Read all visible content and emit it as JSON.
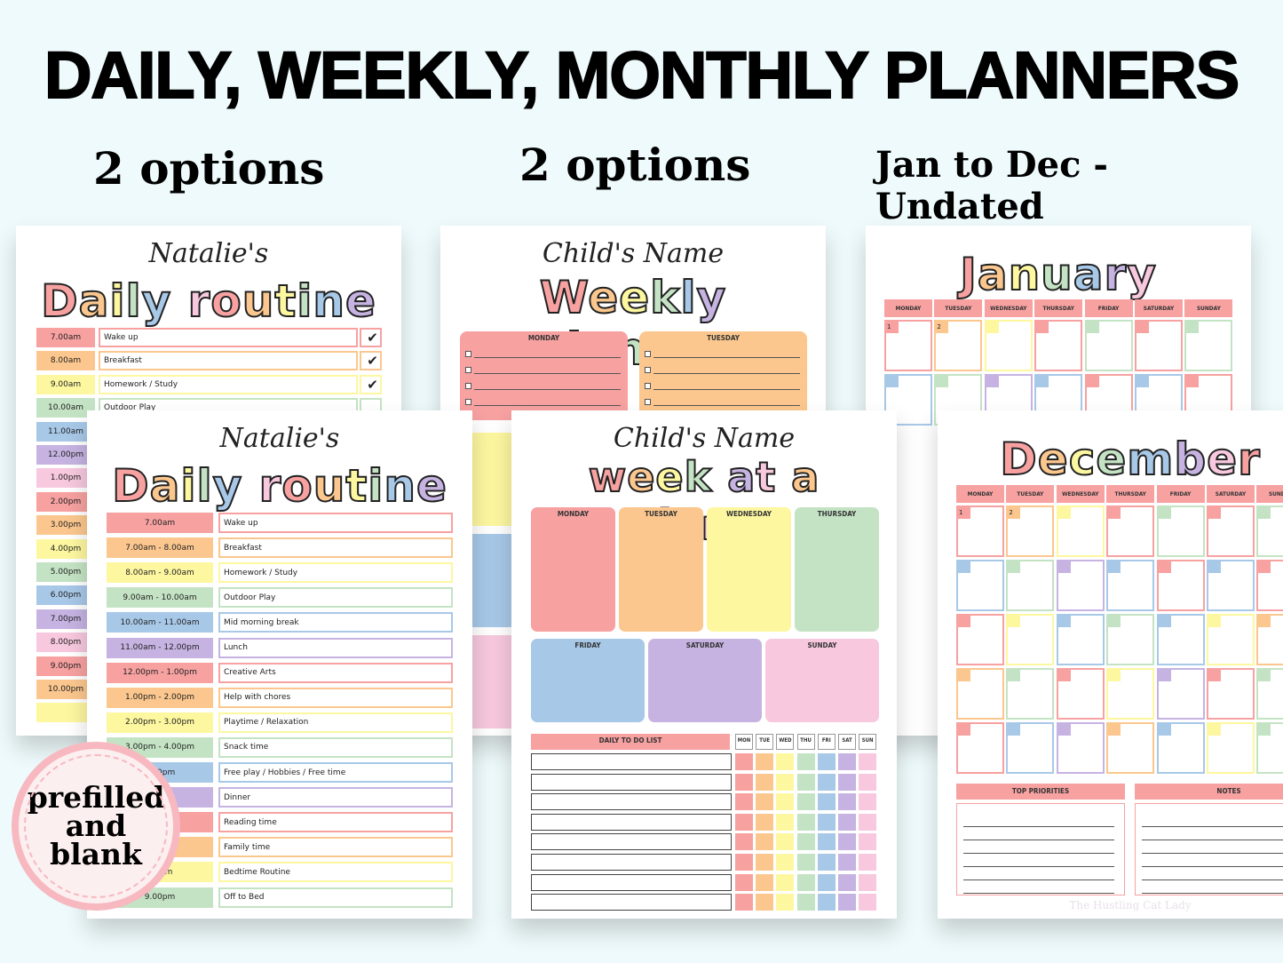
{
  "heading": "DAILY, WEEKLY, MONTHLY PLANNERS",
  "subtitles": [
    "2 options",
    "2 options",
    "Jan to Dec - Undated"
  ],
  "colors": {
    "red": "#f7a1a1",
    "orange": "#fbc78e",
    "yellow": "#fdf7a0",
    "green": "#c4e3c4",
    "blue": "#a8c8e8",
    "purple": "#c6b3e2",
    "pink": "#f7c8de",
    "background": "#eefafb"
  },
  "daily_back": {
    "name": "Natalie's",
    "title": "Daily routine",
    "times": [
      "7.00am",
      "8.00am",
      "9.00am",
      "10.00am",
      "11.00am",
      "12.00pm",
      "1.00pm",
      "2.00pm",
      "3.00pm",
      "4.00pm",
      "5.00pm",
      "6.00pm",
      "7.00pm",
      "8.00pm",
      "9.00pm",
      "10.00pm",
      ""
    ],
    "activities": [
      "Wake up",
      "Breakfast",
      "Homework / Study",
      "Outdoor Play"
    ],
    "checks": [
      "✔",
      "✔",
      "✔",
      ""
    ]
  },
  "daily_front": {
    "name": "Natalie's",
    "title": "Daily routine",
    "times": [
      "7.00am",
      "7.00am - 8.00am",
      "8.00am - 9.00am",
      "9.00am - 10.00am",
      "10.00am - 11.00am",
      "11.00am - 12.00pm",
      "12.00pm - 1.00pm",
      "1.00pm - 2.00pm",
      "2.00pm - 3.00pm",
      "3.00pm - 4.00pm",
      "5.00pm",
      "pm",
      "pm",
      "pm",
      ".00pm",
      "9.00pm"
    ],
    "activities": [
      "Wake up",
      "Breakfast",
      "Homework / Study",
      "Outdoor Play",
      "Mid morning break",
      "Lunch",
      "Creative Arts",
      "Help with chores",
      "Playtime / Relaxation",
      "Snack time",
      "Free play / Hobbies / Free time",
      "Dinner",
      "Reading time",
      "Family time",
      "Bedtime Routine",
      "Off to Bed"
    ]
  },
  "weekly": {
    "name": "Child's Name",
    "title": "Weekly planner",
    "days": [
      "MONDAY",
      "TUESDAY"
    ]
  },
  "glance": {
    "name": "Child's Name",
    "title": "week at a Glance",
    "days_top": [
      "MONDAY",
      "TUESDAY",
      "WEDNESDAY",
      "THURSDAY"
    ],
    "days_bottom": [
      "FRIDAY",
      "SATURDAY",
      "SUNDAY"
    ],
    "todo_label": "DAILY TO DO LIST",
    "check_days": [
      "MON",
      "TUE",
      "WED",
      "THU",
      "FRI",
      "SAT",
      "SUN"
    ]
  },
  "january": {
    "title": "January",
    "weekdays": [
      "MONDAY",
      "TUESDAY",
      "WEDNESDAY",
      "THURSDAY",
      "FRIDAY",
      "SATURDAY",
      "SUNDAY"
    ],
    "dates": [
      "1",
      "2"
    ]
  },
  "december": {
    "title": "December",
    "weekdays": [
      "MONDAY",
      "TUESDAY",
      "WEDNESDAY",
      "THURSDAY",
      "FRIDAY",
      "SATURDAY",
      "SUNDAY"
    ],
    "dates": [
      "1",
      "2"
    ],
    "priorities_label": "TOP PRIORITIES",
    "notes_label": "NOTES",
    "watermark": "The Hustling Cat Lady"
  },
  "badge": {
    "lines": [
      "prefilled",
      "and",
      "blank"
    ]
  }
}
